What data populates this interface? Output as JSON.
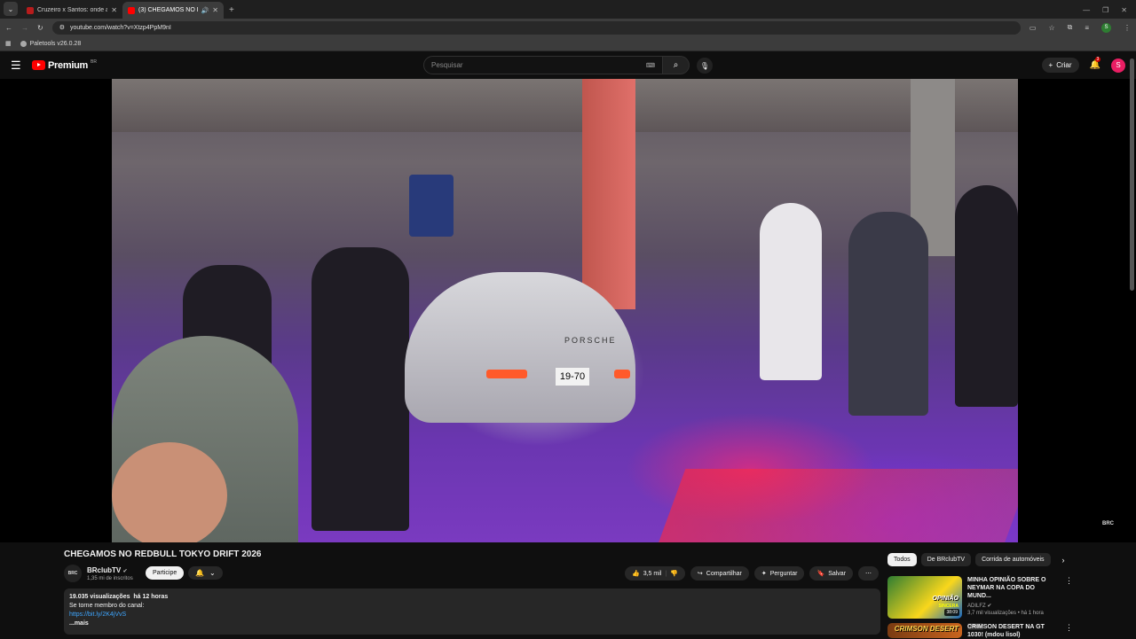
{
  "browser": {
    "tabs": [
      {
        "title": "Cruzeiro x Santos: onde assisti",
        "active": false
      },
      {
        "title": "(3) CHEGAMOS NO REDBU",
        "active": true
      }
    ],
    "url": "youtube.com/watch?v=Xtzp4PpM9nI",
    "bookmark": "Paletools v26.0.28",
    "profile_initial": "S"
  },
  "header": {
    "logo_text": "Premium",
    "logo_country": "BR",
    "search_placeholder": "Pesquisar",
    "create_label": "Criar",
    "notifications": "3",
    "avatar_initial": "S"
  },
  "video": {
    "plate": "19-70",
    "brand": "PORSCHE",
    "watermark": "BRC"
  },
  "watch": {
    "title": "CHEGAMOS NO REDBULL TOKYO DRIFT 2026",
    "channel_avatar": "BRC",
    "channel_name": "BRclubTV",
    "subscribers": "1,35 mi de inscritos",
    "join_label": "Participe",
    "likes": "3,5 mil",
    "share_label": "Compartilhar",
    "ask_label": "Perguntar",
    "save_label": "Salvar",
    "description": {
      "views": "19.035 visualizações",
      "age": "há 12 horas",
      "line1": "Se torne membro do canal:",
      "link": "https://bit.ly/2K4jVvS",
      "more": "...mais"
    }
  },
  "sidebar": {
    "chips": [
      "Todos",
      "De BRclubTV",
      "Corrida de automóveis"
    ],
    "recommendations": [
      {
        "title": "MINHA OPINIÃO SOBRE O NEYMAR NA COPA DO MUND...",
        "channel": "ADILFZ",
        "meta": "3,7 mil visualizações • há 1 hora",
        "badge": "Novo",
        "duration": "38:09",
        "thumb_caption": "OPINIÃO",
        "thumb_subcaption": "SINCERA"
      },
      {
        "title": "CRIMSON DESERT NA GT 1030! (mdou lisol)",
        "thumb_caption": "CRIMSON DESERT"
      }
    ]
  }
}
